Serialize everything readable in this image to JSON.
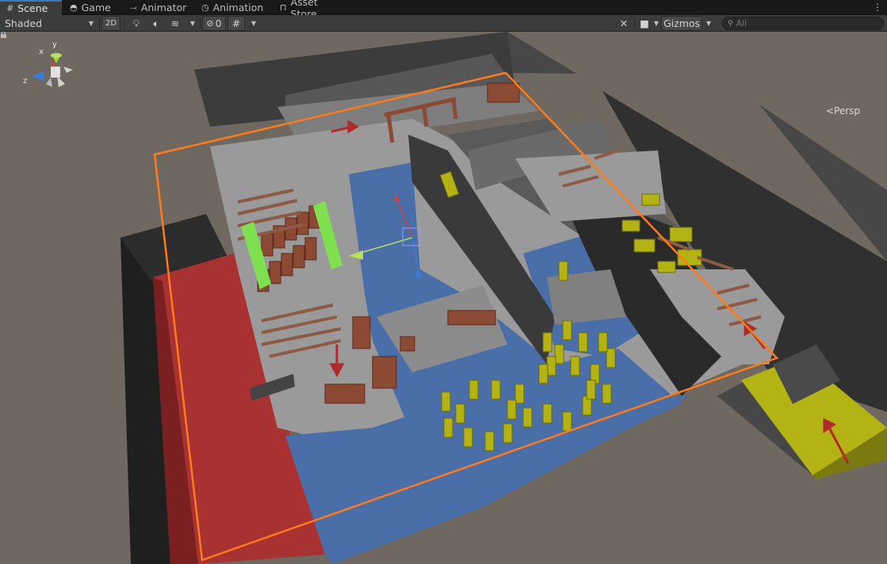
{
  "tabs": [
    {
      "label": "Scene",
      "icon": "grid-icon",
      "active": true
    },
    {
      "label": "Game",
      "icon": "gamepad-icon",
      "active": false
    },
    {
      "label": "Animator",
      "icon": "animator-icon",
      "active": false
    },
    {
      "label": "Animation",
      "icon": "clock-icon",
      "active": false
    },
    {
      "label": "Asset Store",
      "icon": "store-icon",
      "active": false
    }
  ],
  "toolbar": {
    "draw_mode": "Shaded",
    "mode_2d": "2D",
    "hidden_count": "0",
    "gizmos": "Gizmos",
    "search_placeholder": "All"
  },
  "scene": {
    "projection": "Persp",
    "axis_labels": {
      "x": "x",
      "y": "y",
      "z": "z"
    }
  },
  "colors": {
    "background": "#6e6860",
    "selection_outline": "#ff7a1a",
    "water": "#4a6ea8",
    "hazard_red": "#a83232",
    "yellow_pillars": "#b3b316",
    "wall_dark": "#3a3a3a",
    "floor_gray": "#9a9a9a"
  }
}
